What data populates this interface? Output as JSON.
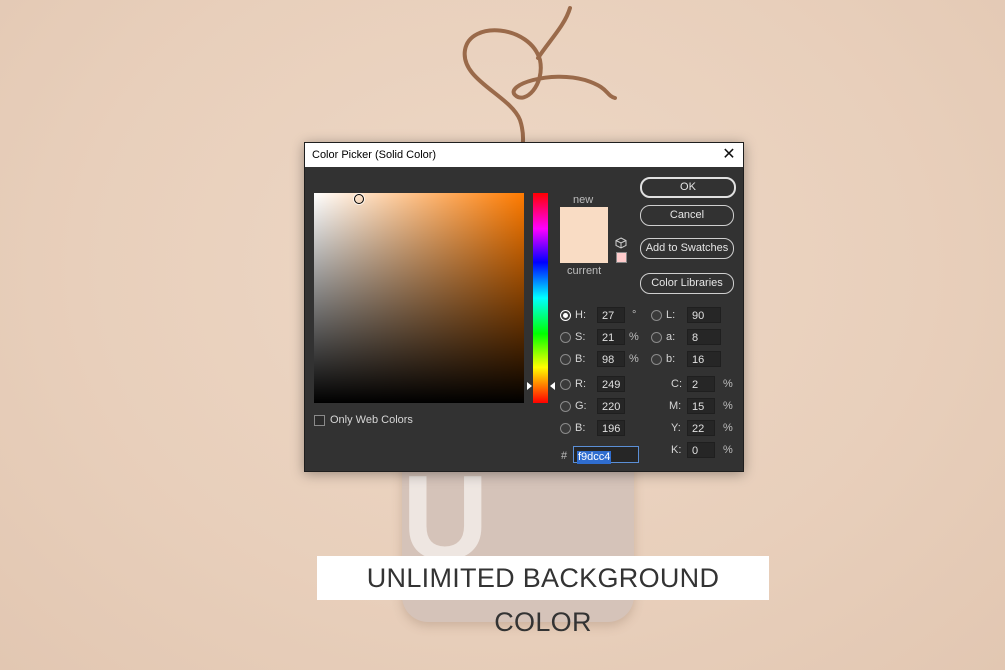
{
  "dialog": {
    "title": "Color Picker (Solid Color)",
    "close_glyph": "✕",
    "new_label": "new",
    "current_label": "current",
    "new_color": "#f9dcc4",
    "current_color": "#f9dcc4",
    "icons": [
      "close-icon",
      "cube-icon"
    ],
    "buttons": {
      "ok": "OK",
      "cancel": "Cancel",
      "add_to_swatches": "Add to Swatches",
      "color_libraries": "Color Libraries"
    },
    "fields": {
      "H": {
        "label": "H:",
        "value": "27",
        "unit": "°"
      },
      "S": {
        "label": "S:",
        "value": "21",
        "unit": "%"
      },
      "Bv": {
        "label": "B:",
        "value": "98",
        "unit": "%"
      },
      "R": {
        "label": "R:",
        "value": "249"
      },
      "G": {
        "label": "G:",
        "value": "220"
      },
      "Bb": {
        "label": "B:",
        "value": "196"
      },
      "L": {
        "label": "L:",
        "value": "90"
      },
      "a": {
        "label": "a:",
        "value": "8"
      },
      "b": {
        "label": "b:",
        "value": "16"
      },
      "C": {
        "label": "C:",
        "value": "2",
        "unit": "%"
      },
      "M": {
        "label": "M:",
        "value": "15",
        "unit": "%"
      },
      "Y": {
        "label": "Y:",
        "value": "22",
        "unit": "%"
      },
      "K": {
        "label": "K:",
        "value": "0",
        "unit": "%"
      }
    },
    "selected_mode": "H",
    "hex_prefix": "#",
    "hex": "f9dcc4",
    "only_web_colors": {
      "label": "Only Web Colors",
      "checked": false
    }
  },
  "tag": {
    "letter": "U"
  },
  "caption": "UNLIMITED BACKGROUND COLOR"
}
